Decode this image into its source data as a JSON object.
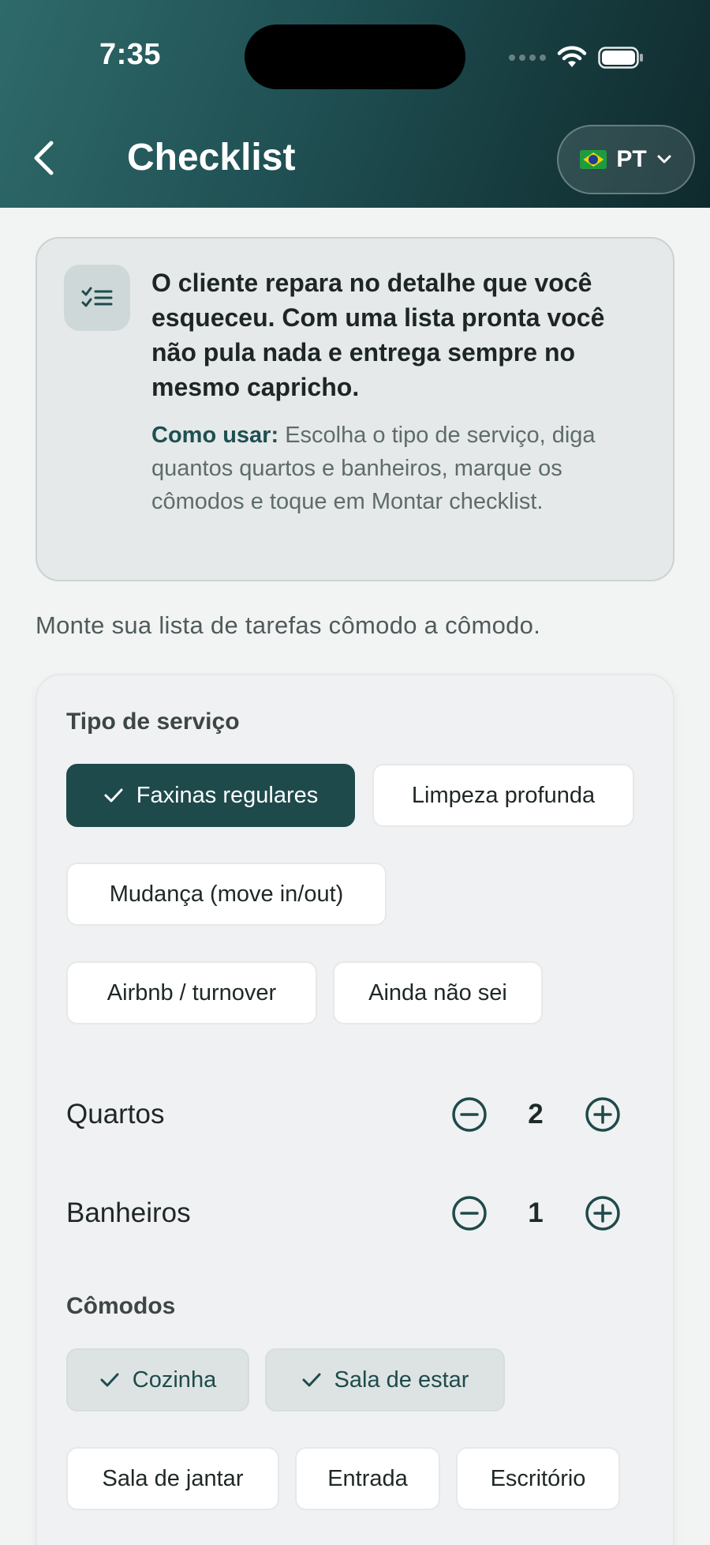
{
  "status_bar": {
    "time": "7:35"
  },
  "header": {
    "title": "Checklist",
    "language": {
      "code": "PT"
    }
  },
  "info_card": {
    "title": "O cliente repara no detalhe que você esqueceu. Com uma lista pronta você não pula nada e entrega sempre no mesmo capricho.",
    "howto_label": "Como usar:",
    "howto_text": " Escolha o tipo de serviço, diga quantos quartos e banheiros, marque os cômodos e toque em Montar checklist."
  },
  "subtitle": "Monte sua lista de tarefas cômodo a cômodo.",
  "form": {
    "service_type_label": "Tipo de serviço",
    "service_types": [
      {
        "label": "Faxinas regulares",
        "selected": true
      },
      {
        "label": "Limpeza profunda",
        "selected": false
      },
      {
        "label": "Mudança (move in/out)",
        "selected": false
      },
      {
        "label": "Airbnb / turnover",
        "selected": false
      },
      {
        "label": "Ainda não sei",
        "selected": false
      }
    ],
    "bedrooms": {
      "label": "Quartos",
      "value": "2"
    },
    "bathrooms": {
      "label": "Banheiros",
      "value": "1"
    },
    "rooms_label": "Cômodos",
    "rooms": [
      {
        "label": "Cozinha",
        "selected": true
      },
      {
        "label": "Sala de estar",
        "selected": true
      },
      {
        "label": "Sala de jantar",
        "selected": false
      },
      {
        "label": "Entrada",
        "selected": false
      },
      {
        "label": "Escritório",
        "selected": false
      }
    ]
  },
  "colors": {
    "primary": "#1f4a4b",
    "header_gradient_start": "#2f6a6a",
    "header_gradient_end": "#0f2a2d",
    "background": "#f2f3f3"
  }
}
